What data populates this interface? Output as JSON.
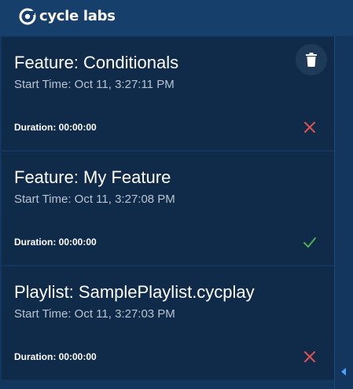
{
  "app": {
    "brand": "cycle labs"
  },
  "results": [
    {
      "title": "Feature: Conditionals",
      "start_time": "Start Time: Oct 11, 3:27:11 PM",
      "duration": "Duration: 00:00:00",
      "status": "failed",
      "status_icon": "x-icon",
      "status_color": "#e05252"
    },
    {
      "title": "Feature: My Feature",
      "start_time": "Start Time: Oct 11, 3:27:08 PM",
      "duration": "Duration: 00:00:00",
      "status": "passed",
      "status_icon": "check-icon",
      "status_color": "#4caf50"
    },
    {
      "title": "Playlist: SamplePlaylist.cycplay",
      "start_time": "Start Time: Oct 11, 3:27:03 PM",
      "duration": "Duration: 00:00:00",
      "status": "failed",
      "status_icon": "x-icon",
      "status_color": "#e05252"
    }
  ],
  "icons": {
    "delete": "trash-icon",
    "collapse": "chevron-left-icon",
    "logo": "cycle-logo-icon"
  },
  "colors": {
    "header_bg": "#173f6b",
    "card_bg": "#102b4a",
    "page_bg": "#12365e"
  }
}
